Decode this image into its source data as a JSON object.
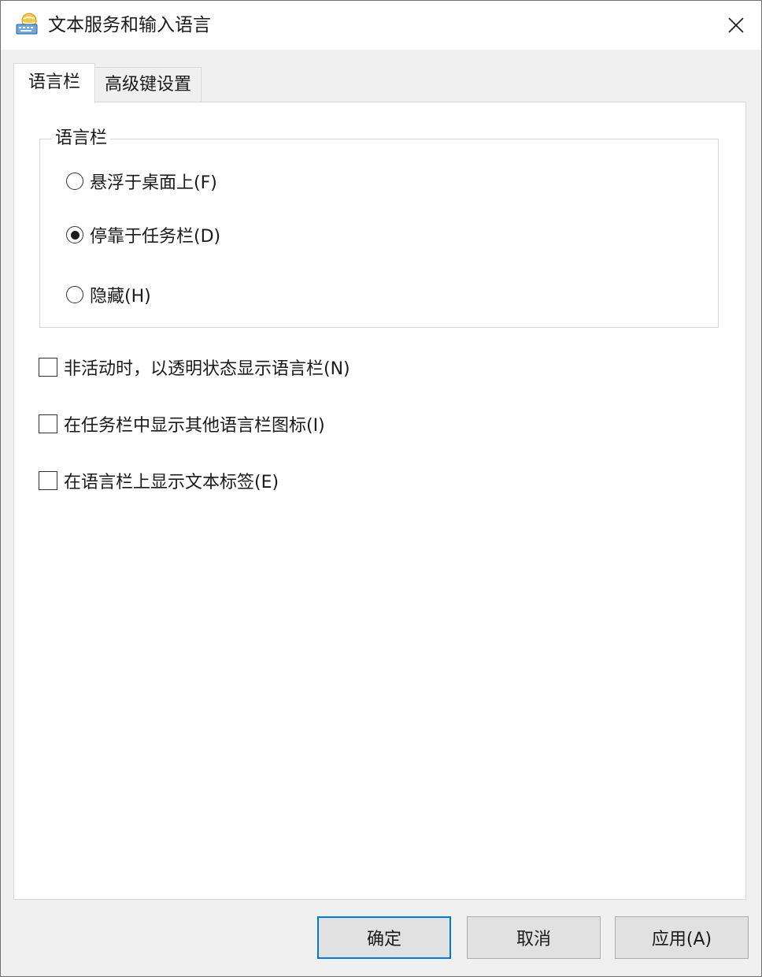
{
  "window": {
    "title": "文本服务和输入语言"
  },
  "tabs": [
    {
      "label": "语言栏",
      "active": true
    },
    {
      "label": "高级键设置",
      "active": false
    }
  ],
  "language_bar_group": {
    "label": "语言栏",
    "options": [
      {
        "label": "悬浮于桌面上(F)",
        "selected": false
      },
      {
        "label": "停靠于任务栏(D)",
        "selected": true
      },
      {
        "label": "隐藏(H)",
        "selected": false
      }
    ]
  },
  "checkboxes": [
    {
      "label": "非活动时，以透明状态显示语言栏(N)",
      "checked": false
    },
    {
      "label": "在任务栏中显示其他语言栏图标(I)",
      "checked": false
    },
    {
      "label": "在语言栏上显示文本标签(E)",
      "checked": false
    }
  ],
  "buttons": {
    "ok": "确定",
    "cancel": "取消",
    "apply": "应用(A)"
  },
  "colors": {
    "accent": "#0078d7",
    "panel_bg": "#ffffff",
    "window_bg": "#f0f0f0"
  }
}
